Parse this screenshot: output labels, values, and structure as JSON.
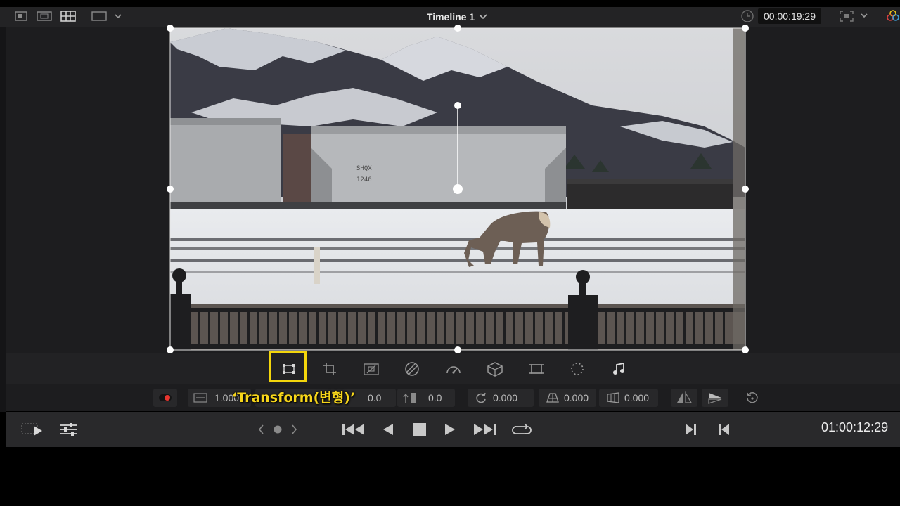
{
  "header": {
    "timeline_title": "Timeline 1",
    "timecode": "00:00:19:29"
  },
  "inspector_tools": [
    {
      "name": "transform-tool",
      "icon": "transform-icon",
      "selected": true
    },
    {
      "name": "crop-tool",
      "icon": "crop-icon"
    },
    {
      "name": "dynamic-zoom-tool",
      "icon": "dynamic-zoom-icon"
    },
    {
      "name": "open-fx-overlay-tool",
      "icon": "fx-overlay-icon"
    },
    {
      "name": "smart-reframe-tool",
      "icon": "speedometer-icon"
    },
    {
      "name": "3d-tool",
      "icon": "cube-icon"
    },
    {
      "name": "fit-tool",
      "icon": "frame-icon"
    },
    {
      "name": "annotation-tool",
      "icon": "dotted-circle-icon"
    },
    {
      "name": "audio-tool",
      "icon": "music-note-icon"
    }
  ],
  "params": {
    "zoom": "1.000",
    "position_x": "0.0",
    "position_y": "0.0",
    "rotation": "0.000",
    "pitch": "0.000",
    "yaw": "0.000"
  },
  "annotation": "‘Transform(변형)’",
  "transport": {
    "timecode": "01:00:12:29"
  },
  "colors": {
    "highlight": "#f3d60c",
    "record_dot": "#e8352e"
  }
}
